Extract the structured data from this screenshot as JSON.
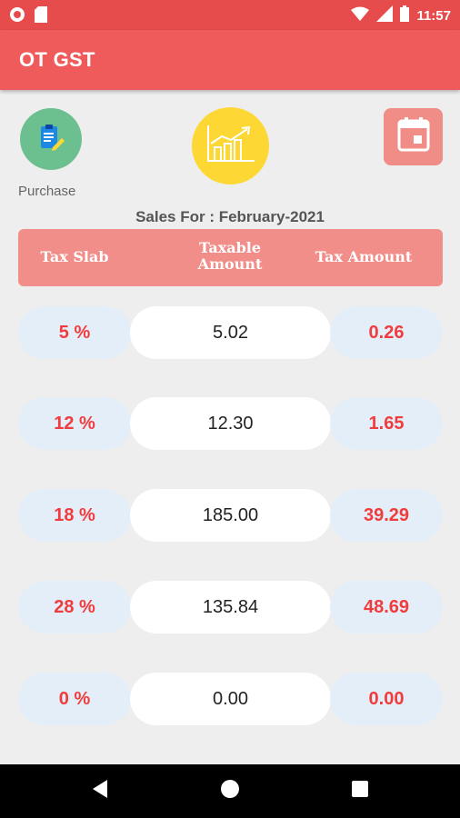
{
  "status_bar": {
    "time": "11:57"
  },
  "app_bar": {
    "title": "OT GST"
  },
  "shortcuts": {
    "purchase_label": "Purchase"
  },
  "sales_for": "Sales For : February-2021",
  "table": {
    "headers": {
      "tax_slab": "Tax Slab",
      "taxable_line1": "Taxable",
      "taxable_line2": "Amount",
      "tax_amount": "Tax Amount"
    },
    "rows": [
      {
        "slab": "5 %",
        "taxable": "5.02",
        "tax": "0.26"
      },
      {
        "slab": "12 %",
        "taxable": "12.30",
        "tax": "1.65"
      },
      {
        "slab": "18 %",
        "taxable": "185.00",
        "tax": "39.29"
      },
      {
        "slab": "28 %",
        "taxable": "135.84",
        "tax": "48.69"
      },
      {
        "slab": "0 %",
        "taxable": "0.00",
        "tax": "0.00"
      }
    ]
  },
  "colors": {
    "status_bar": "#e64c4c",
    "app_bar": "#ef5b5b",
    "header": "#f28e8a",
    "accent_red": "#f03c3c",
    "pill_blue": "#e3eef9",
    "purchase_green": "#6cc090",
    "sales_yellow": "#fdd835",
    "calendar": "#f08d86"
  },
  "icons": [
    "notification-icon",
    "sd-card-icon",
    "wifi-icon",
    "signal-icon",
    "battery-icon",
    "clipboard-icon",
    "growth-chart-icon",
    "calendar-icon",
    "back-icon",
    "home-icon",
    "recents-icon"
  ]
}
